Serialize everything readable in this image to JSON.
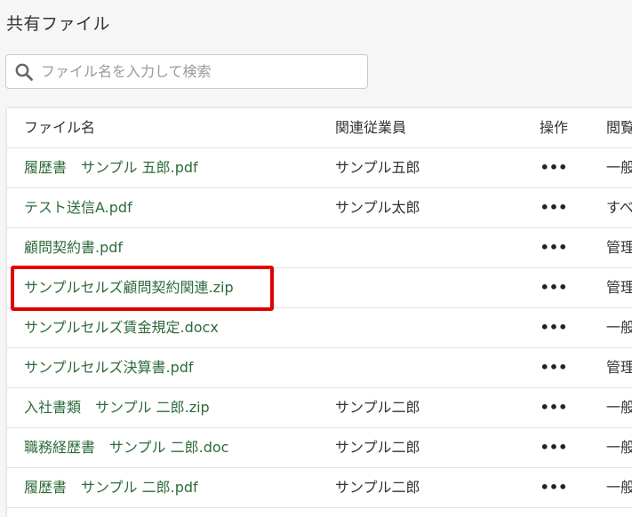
{
  "page": {
    "title": "共有ファイル"
  },
  "search": {
    "placeholder": "ファイル名を入力して検索",
    "value": ""
  },
  "table": {
    "headers": {
      "name": "ファイル名",
      "employee": "関連従業員",
      "action": "操作",
      "permission": "閲覧"
    },
    "rows": [
      {
        "name": "履歴書　サンプル 五郎.pdf",
        "employee": "サンプル五郎",
        "action": "•••",
        "permission": "一般"
      },
      {
        "name": "テスト送信A.pdf",
        "employee": "サンプル太郎",
        "action": "•••",
        "permission": "すべ"
      },
      {
        "name": "顧問契約書.pdf",
        "employee": "",
        "action": "•••",
        "permission": "管理"
      },
      {
        "name": "サンプルセルズ顧問契約関連.zip",
        "employee": "",
        "action": "•••",
        "permission": "管理"
      },
      {
        "name": "サンプルセルズ賃金規定.docx",
        "employee": "",
        "action": "•••",
        "permission": "一般"
      },
      {
        "name": "サンプルセルズ決算書.pdf",
        "employee": "",
        "action": "•••",
        "permission": "管理"
      },
      {
        "name": "入社書類　サンプル 二郎.zip",
        "employee": "サンプル二郎",
        "action": "•••",
        "permission": "一般"
      },
      {
        "name": "職務経歴書　サンプル 二郎.doc",
        "employee": "サンプル二郎",
        "action": "•••",
        "permission": "一般"
      },
      {
        "name": "履歴書　サンプル 二郎.pdf",
        "employee": "サンプル二郎",
        "action": "•••",
        "permission": "一般"
      }
    ]
  },
  "colors": {
    "link": "#2e6b3a",
    "highlight": "#e10000"
  },
  "icons": {
    "search": "search-icon",
    "more": "more-options-icon"
  }
}
